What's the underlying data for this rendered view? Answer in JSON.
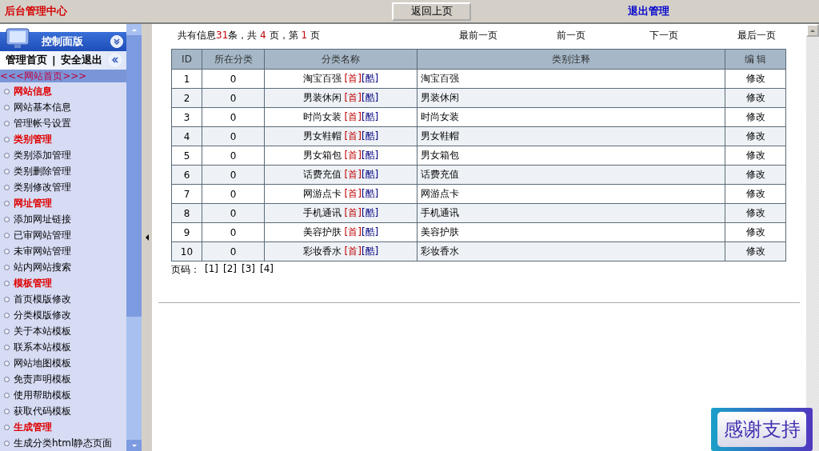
{
  "topbar": {
    "title": "后台管理中心",
    "back_button": "返回上页",
    "logout_link": "退出管理"
  },
  "sidebar": {
    "panel_title": "控制面版",
    "home_link": "管理首页",
    "separator": "|",
    "exit_link": "安全退出",
    "site_home_link": "<<<网站首页>>>",
    "items": [
      {
        "kind": "heading",
        "label": "网站信息"
      },
      {
        "kind": "link",
        "label": "网站基本信息"
      },
      {
        "kind": "link",
        "label": "管理帐号设置"
      },
      {
        "kind": "heading",
        "label": "类别管理"
      },
      {
        "kind": "link",
        "label": "类别添加管理"
      },
      {
        "kind": "link",
        "label": "类别删除管理"
      },
      {
        "kind": "link",
        "label": "类别修改管理"
      },
      {
        "kind": "heading",
        "label": "网址管理"
      },
      {
        "kind": "link",
        "label": "添加网址链接"
      },
      {
        "kind": "link",
        "label": "已审网站管理"
      },
      {
        "kind": "link",
        "label": "未审网站管理"
      },
      {
        "kind": "link",
        "label": "站内网站搜索"
      },
      {
        "kind": "heading",
        "label": "模板管理"
      },
      {
        "kind": "link",
        "label": "首页模版修改"
      },
      {
        "kind": "link",
        "label": "分类模版修改"
      },
      {
        "kind": "link",
        "label": "关于本站模板"
      },
      {
        "kind": "link",
        "label": "联系本站模板"
      },
      {
        "kind": "link",
        "label": "网站地图模板"
      },
      {
        "kind": "link",
        "label": "免责声明模板"
      },
      {
        "kind": "link",
        "label": "使用帮助模板"
      },
      {
        "kind": "link",
        "label": "获取代码模板"
      },
      {
        "kind": "heading",
        "label": "生成管理"
      },
      {
        "kind": "link",
        "label": "生成分类html静态页面"
      }
    ]
  },
  "summary": [
    {
      "text": "共有信息",
      "highlight": false
    },
    {
      "text": "31",
      "highlight": true
    },
    {
      "text": "条，共 ",
      "highlight": false
    },
    {
      "text": "4",
      "highlight": true
    },
    {
      "text": " 页，第 ",
      "highlight": false
    },
    {
      "text": "1",
      "highlight": true
    },
    {
      "text": " 页",
      "highlight": false
    }
  ],
  "nav_links": [
    "最前一页",
    "前一页",
    "下一页",
    "最后一页"
  ],
  "table": {
    "columns": [
      "ID",
      "所在分类",
      "分类名称",
      "类别注释",
      "编 辑"
    ],
    "rows": [
      {
        "id": "1",
        "parent": "0",
        "name": "淘宝百强",
        "first_link": "[首]",
        "cool_link": "[酷]",
        "note": "淘宝百强",
        "edit": "修改"
      },
      {
        "id": "2",
        "parent": "0",
        "name": "男装休闲",
        "first_link": "[首]",
        "cool_link": "[酷]",
        "note": "男装休闲",
        "edit": "修改"
      },
      {
        "id": "3",
        "parent": "0",
        "name": "时尚女装",
        "first_link": "[首]",
        "cool_link": "[酷]",
        "note": "时尚女装",
        "edit": "修改"
      },
      {
        "id": "4",
        "parent": "0",
        "name": "男女鞋帽",
        "first_link": "[首]",
        "cool_link": "[酷]",
        "note": "男女鞋帽",
        "edit": "修改"
      },
      {
        "id": "5",
        "parent": "0",
        "name": "男女箱包",
        "first_link": "[首]",
        "cool_link": "[酷]",
        "note": "男女箱包",
        "edit": "修改"
      },
      {
        "id": "6",
        "parent": "0",
        "name": "话费充值",
        "first_link": "[首]",
        "cool_link": "[酷]",
        "note": "话费充值",
        "edit": "修改"
      },
      {
        "id": "7",
        "parent": "0",
        "name": "网游点卡",
        "first_link": "[首]",
        "cool_link": "[酷]",
        "note": "网游点卡",
        "edit": "修改"
      },
      {
        "id": "8",
        "parent": "0",
        "name": "手机通讯",
        "first_link": "[首]",
        "cool_link": "[酷]",
        "note": "手机通讯",
        "edit": "修改"
      },
      {
        "id": "9",
        "parent": "0",
        "name": "美容护肤",
        "first_link": "[首]",
        "cool_link": "[酷]",
        "note": "美容护肤",
        "edit": "修改"
      },
      {
        "id": "10",
        "parent": "0",
        "name": "彩妆香水",
        "first_link": "[首]",
        "cool_link": "[酷]",
        "note": "彩妆香水",
        "edit": "修改"
      }
    ]
  },
  "pager": {
    "label": "页码：",
    "pages": [
      "[1]",
      "[2]",
      "[3]",
      "[4]"
    ]
  },
  "thanks_badge": "感谢支持"
}
